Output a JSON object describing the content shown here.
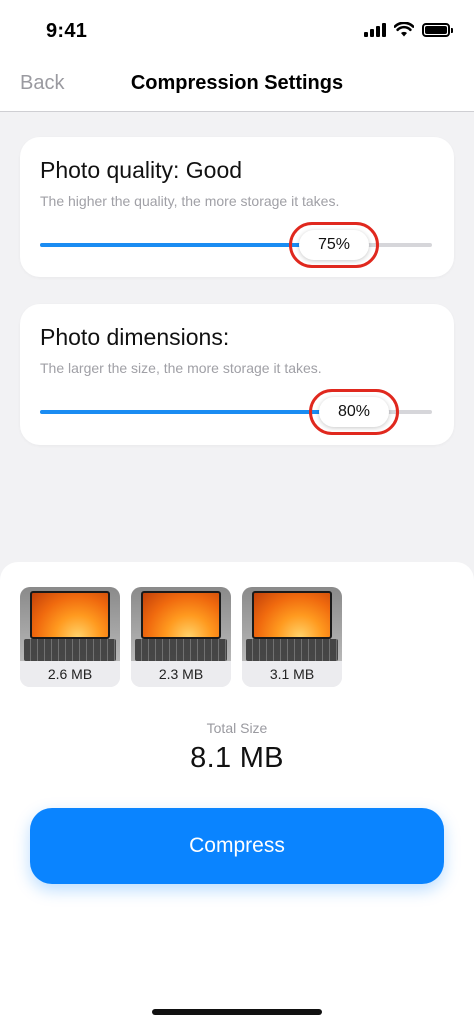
{
  "status_bar": {
    "time": "9:41",
    "signal_icon": "cellular-signal-icon",
    "wifi_icon": "wifi-icon",
    "battery_icon": "battery-icon"
  },
  "nav": {
    "back_label": "Back",
    "title": "Compression Settings"
  },
  "quality": {
    "title": "Photo quality: Good",
    "subtitle": "The higher the quality, the more storage it takes.",
    "value_label": "75%",
    "value_fraction": 0.75
  },
  "dimensions": {
    "title": "Photo dimensions:",
    "subtitle": "The larger the size, the more storage it takes.",
    "value_label": "80%",
    "value_fraction": 0.8
  },
  "photos": [
    {
      "size": "2.6 MB"
    },
    {
      "size": "2.3 MB"
    },
    {
      "size": "3.1 MB"
    }
  ],
  "summary": {
    "label": "Total Size",
    "value": "8.1 MB"
  },
  "actions": {
    "compress_label": "Compress"
  },
  "colors": {
    "accent": "#0a84ff",
    "slider_fill": "#1a8cf2",
    "highlight": "#e0281e"
  }
}
